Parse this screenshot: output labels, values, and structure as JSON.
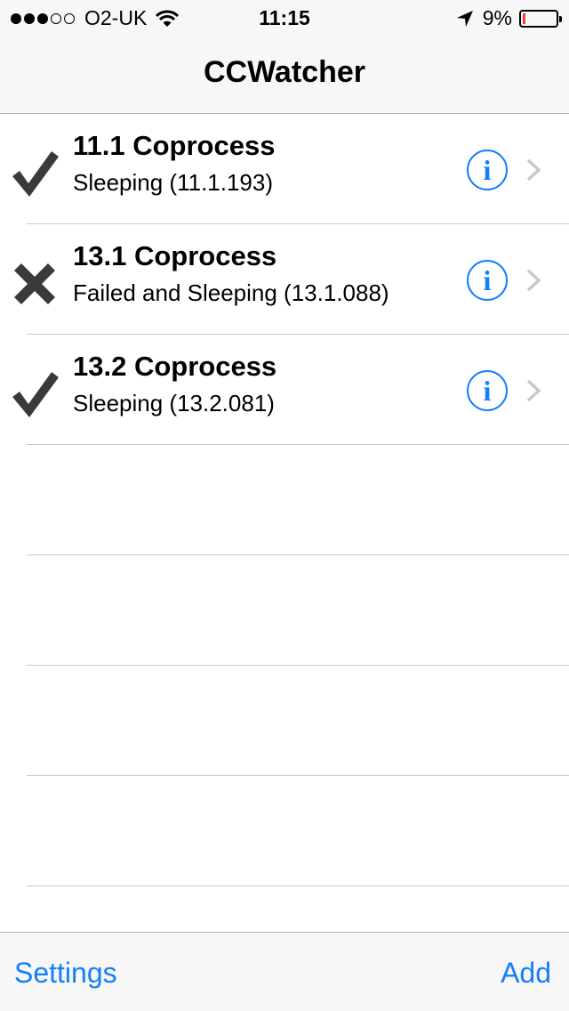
{
  "status_bar": {
    "carrier": "O2-UK",
    "time": "11:15",
    "battery_percent": "9%",
    "battery_level": 0.09,
    "signal_dots_filled": 3,
    "signal_dots_total": 5
  },
  "nav": {
    "title": "CCWatcher"
  },
  "items": [
    {
      "title": "11.1 Coprocess",
      "subtitle": "Sleeping (11.1.193)",
      "state": "ok"
    },
    {
      "title": "13.1 Coprocess",
      "subtitle": "Failed and Sleeping (13.1.088)",
      "state": "failed"
    },
    {
      "title": "13.2 Coprocess",
      "subtitle": "Sleeping (13.2.081)",
      "state": "ok"
    }
  ],
  "info_glyph": "i",
  "toolbar": {
    "settings_label": "Settings",
    "add_label": "Add"
  },
  "colors": {
    "accent": "#147efb",
    "battery_low": "#ff3b30",
    "status_icon": "#3a3a3a",
    "chevron": "#c7c7cc"
  }
}
